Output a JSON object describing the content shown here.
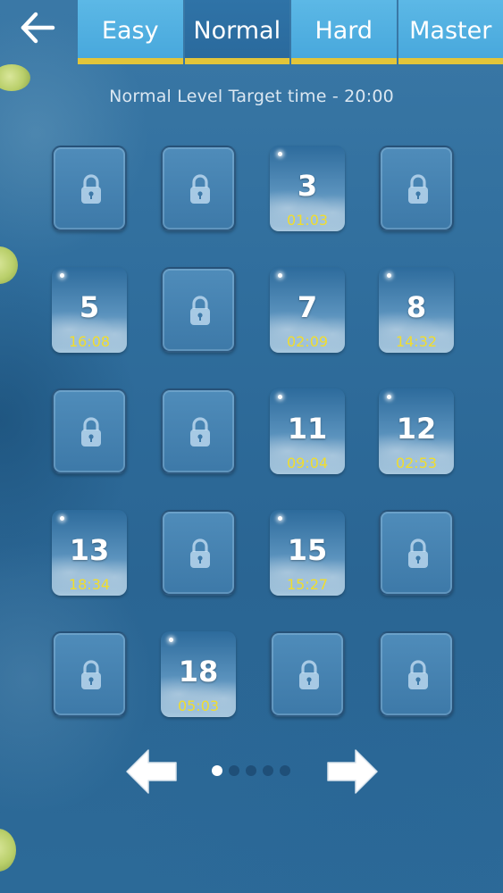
{
  "header": {
    "back_icon": "arrow-left-icon",
    "tabs": [
      {
        "label": "Easy",
        "active": false
      },
      {
        "label": "Normal",
        "active": true
      },
      {
        "label": "Hard",
        "active": false
      },
      {
        "label": "Master",
        "active": false
      }
    ]
  },
  "subtitle": "Normal Level  Target time - 20:00",
  "levels": [
    {
      "number": "",
      "time": "",
      "locked": true
    },
    {
      "number": "",
      "time": "",
      "locked": true
    },
    {
      "number": "3",
      "time": "01:03",
      "locked": false
    },
    {
      "number": "",
      "time": "",
      "locked": true
    },
    {
      "number": "5",
      "time": "16:08",
      "locked": false
    },
    {
      "number": "",
      "time": "",
      "locked": true
    },
    {
      "number": "7",
      "time": "02:09",
      "locked": false
    },
    {
      "number": "8",
      "time": "14:32",
      "locked": false
    },
    {
      "number": "",
      "time": "",
      "locked": true
    },
    {
      "number": "",
      "time": "",
      "locked": true
    },
    {
      "number": "11",
      "time": "09:04",
      "locked": false
    },
    {
      "number": "12",
      "time": "02:53",
      "locked": false
    },
    {
      "number": "13",
      "time": "18:34",
      "locked": false
    },
    {
      "number": "",
      "time": "",
      "locked": true
    },
    {
      "number": "15",
      "time": "15:27",
      "locked": false
    },
    {
      "number": "",
      "time": "",
      "locked": true
    },
    {
      "number": "",
      "time": "",
      "locked": true
    },
    {
      "number": "18",
      "time": "05:03",
      "locked": false
    },
    {
      "number": "",
      "time": "",
      "locked": true
    },
    {
      "number": "",
      "time": "",
      "locked": true
    }
  ],
  "pagination": {
    "pages": 5,
    "current": 1
  },
  "colors": {
    "tab": "#48a8dc",
    "tab_active": "#2a6a9d",
    "accent": "#e2c53a",
    "time": "#f1dd2c"
  }
}
